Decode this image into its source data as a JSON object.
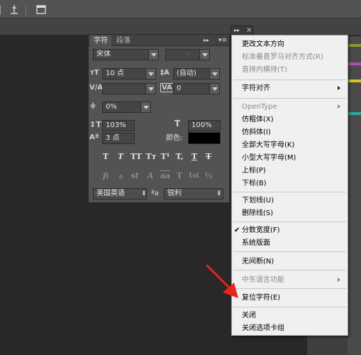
{
  "panel": {
    "tabs": [
      "字符",
      "段落"
    ],
    "font_family": "宋体",
    "font_style": "-",
    "font_size": "10 点",
    "leading": "(自动)",
    "kerning": "",
    "tracking": "0",
    "tsume": "0%",
    "vertical_scale": "103%",
    "horizontal_scale": "100%",
    "baseline_shift": "3 点",
    "color_label": "颜色:",
    "language": "美国英语",
    "anti_alias": "锐利",
    "aa_icon": "ªa",
    "style_buttons": [
      "T",
      "T",
      "TT",
      "Tт",
      "T¹",
      "T,",
      "T",
      "T"
    ],
    "ot_buttons": [
      "fi",
      "ℴ",
      "st",
      "A",
      "aa",
      "T",
      "1st",
      "½"
    ]
  },
  "menu": {
    "items": [
      {
        "label": "更改文本方向",
        "enabled": true
      },
      {
        "label": "标准垂直罗马对齐方式(R)",
        "enabled": false
      },
      {
        "label": "直排内横排(T)",
        "enabled": false
      },
      {
        "label": "字符对齐",
        "enabled": true,
        "submenu": true
      },
      {
        "label": "OpenType",
        "enabled": false,
        "submenu": true
      },
      {
        "label": "仿粗体(X)",
        "enabled": true
      },
      {
        "label": "仿斜体(I)",
        "enabled": true
      },
      {
        "label": "全部大写字母(K)",
        "enabled": true
      },
      {
        "label": "小型大写字母(M)",
        "enabled": true
      },
      {
        "label": "上标(P)",
        "enabled": true
      },
      {
        "label": "下标(B)",
        "enabled": true
      },
      {
        "label": "下划线(U)",
        "enabled": true
      },
      {
        "label": "删除线(S)",
        "enabled": true
      },
      {
        "label": "分数宽度(F)",
        "enabled": true,
        "checked": true
      },
      {
        "label": "系统版面",
        "enabled": true
      },
      {
        "label": "无间断(N)",
        "enabled": true
      },
      {
        "label": "中东语言功能",
        "enabled": false,
        "submenu": true
      },
      {
        "label": "复位字符(E)",
        "enabled": true
      },
      {
        "label": "关闭",
        "enabled": true
      },
      {
        "label": "关闭选项卡组",
        "enabled": true
      }
    ],
    "check_glyph": "✔"
  },
  "float_head": {
    "collapse": "▸▸",
    "close": "×"
  },
  "colors": {
    "annotation_arrow": "#e8231c",
    "text_color_swatch": "#000000"
  }
}
